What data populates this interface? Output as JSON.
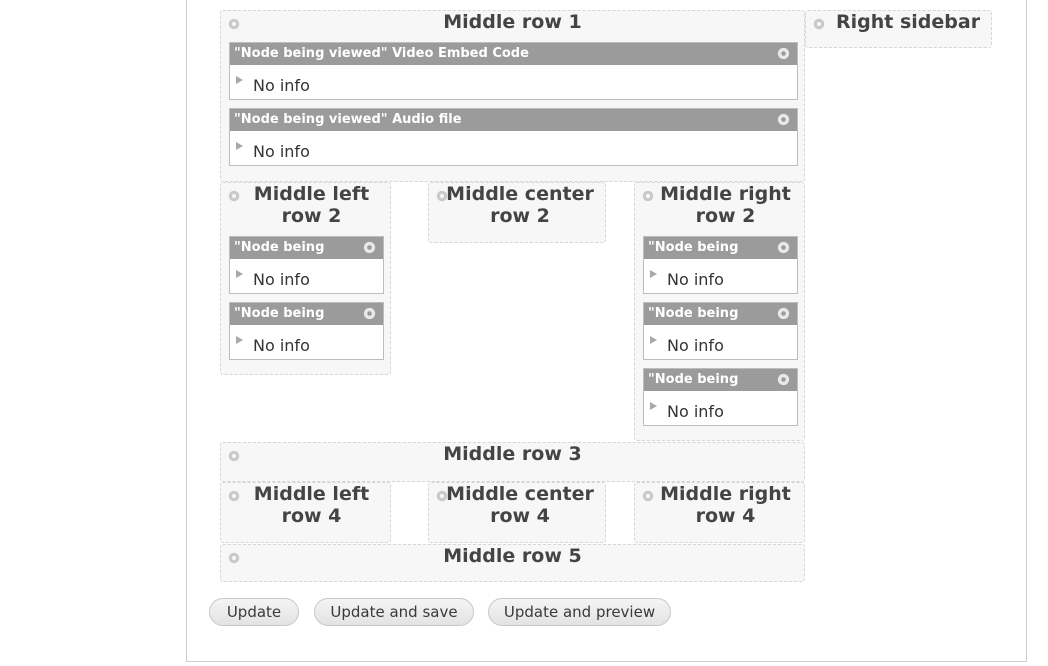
{
  "regions": {
    "middle_row_1": "Middle row 1",
    "right_sidebar": "Right sidebar",
    "middle_left_row_2": "Middle left\nrow 2",
    "middle_center_row_2": "Middle center\nrow 2",
    "middle_right_row_2": "Middle right\nrow 2",
    "middle_row_3": "Middle row 3",
    "middle_left_row_4": "Middle left\nrow 4",
    "middle_center_row_4": "Middle center\nrow 4",
    "middle_right_row_4": "Middle right\nrow 4",
    "middle_row_5": "Middle row 5"
  },
  "panes": {
    "video_embed": {
      "title": "\"Node being viewed\" Video Embed Code",
      "body": "No info"
    },
    "audio_file": {
      "title": "\"Node being viewed\" Audio file",
      "body": "No info"
    },
    "left_1": {
      "title": "\"Node being",
      "body": "No info"
    },
    "left_2": {
      "title": "\"Node being",
      "body": "No info"
    },
    "right_1": {
      "title": "\"Node being",
      "body": "No info"
    },
    "right_2": {
      "title": "\"Node being",
      "body": "No info"
    },
    "right_3": {
      "title": "\"Node being",
      "body": "No info"
    }
  },
  "buttons": {
    "update": "Update",
    "update_save": "Update and save",
    "update_preview": "Update and preview"
  },
  "icons": {
    "region_settings": "gear-icon",
    "pane_settings": "gear-icon",
    "expand": "triangle-right-icon"
  },
  "colors": {
    "pane_header": "#9b9b9b",
    "region_bg": "#f7f7f7"
  }
}
